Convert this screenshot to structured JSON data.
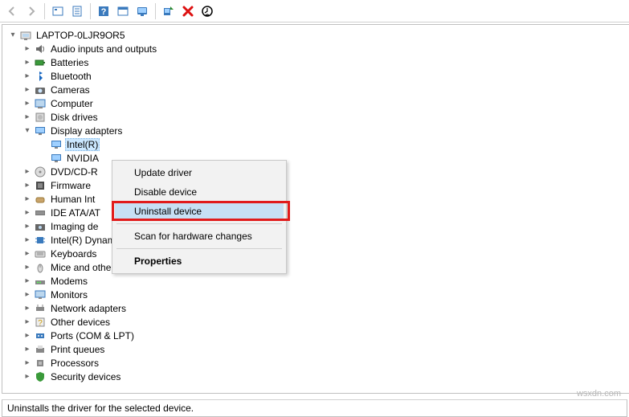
{
  "toolbar": {
    "buttons": [
      {
        "name": "back-arrow",
        "disabled": true
      },
      {
        "name": "forward-arrow",
        "disabled": true
      },
      {
        "name": "show-hidden"
      },
      {
        "name": "properties"
      },
      {
        "name": "help"
      },
      {
        "name": "action"
      },
      {
        "name": "view-monitor"
      },
      {
        "name": "scan-hardware"
      },
      {
        "name": "uninstall-x"
      },
      {
        "name": "update-driver"
      }
    ]
  },
  "root": {
    "label": "LAPTOP-0LJR9OR5",
    "expanded": true
  },
  "categories": [
    {
      "label": "Audio inputs and outputs",
      "icon": "audio",
      "exp": false
    },
    {
      "label": "Batteries",
      "icon": "battery",
      "exp": false
    },
    {
      "label": "Bluetooth",
      "icon": "bluetooth",
      "exp": false
    },
    {
      "label": "Cameras",
      "icon": "camera",
      "exp": false
    },
    {
      "label": "Computer",
      "icon": "computer",
      "exp": false
    },
    {
      "label": "Disk drives",
      "icon": "disk",
      "exp": false
    },
    {
      "label": "Display adapters",
      "icon": "display",
      "exp": true,
      "children": [
        {
          "label": "Intel(R)",
          "icon": "display",
          "selected": true
        },
        {
          "label": "NVIDIA",
          "icon": "display"
        }
      ]
    },
    {
      "label": "DVD/CD-R",
      "icon": "dvd",
      "exp": false,
      "truncated": true
    },
    {
      "label": "Firmware",
      "icon": "firmware",
      "exp": false
    },
    {
      "label": "Human Int",
      "icon": "hid",
      "exp": false,
      "truncated": true
    },
    {
      "label": "IDE ATA/AT",
      "icon": "ide",
      "exp": false,
      "truncated": true
    },
    {
      "label": "Imaging de",
      "icon": "imaging",
      "exp": false,
      "truncated": true
    },
    {
      "label": "Intel(R) Dynamic Platform and Thermal Framework",
      "icon": "chip",
      "exp": false
    },
    {
      "label": "Keyboards",
      "icon": "keyboard",
      "exp": false
    },
    {
      "label": "Mice and other pointing devices",
      "icon": "mouse",
      "exp": false
    },
    {
      "label": "Modems",
      "icon": "modem",
      "exp": false
    },
    {
      "label": "Monitors",
      "icon": "monitor",
      "exp": false
    },
    {
      "label": "Network adapters",
      "icon": "network",
      "exp": false
    },
    {
      "label": "Other devices",
      "icon": "other",
      "exp": false
    },
    {
      "label": "Ports (COM & LPT)",
      "icon": "port",
      "exp": false
    },
    {
      "label": "Print queues",
      "icon": "print",
      "exp": false
    },
    {
      "label": "Processors",
      "icon": "cpu",
      "exp": false
    },
    {
      "label": "Security devices",
      "icon": "security",
      "exp": false
    }
  ],
  "context_menu": {
    "items": [
      {
        "label": "Update driver",
        "name": "ctx-update-driver"
      },
      {
        "label": "Disable device",
        "name": "ctx-disable-device"
      },
      {
        "label": "Uninstall device",
        "name": "ctx-uninstall-device",
        "hovered": true,
        "highlight_box": true
      },
      {
        "sep": true
      },
      {
        "label": "Scan for hardware changes",
        "name": "ctx-scan-hardware"
      },
      {
        "sep": true
      },
      {
        "label": "Properties",
        "name": "ctx-properties",
        "bold": true
      }
    ]
  },
  "status_bar": "Uninstalls the driver for the selected device.",
  "watermark": "wsxdn.com"
}
